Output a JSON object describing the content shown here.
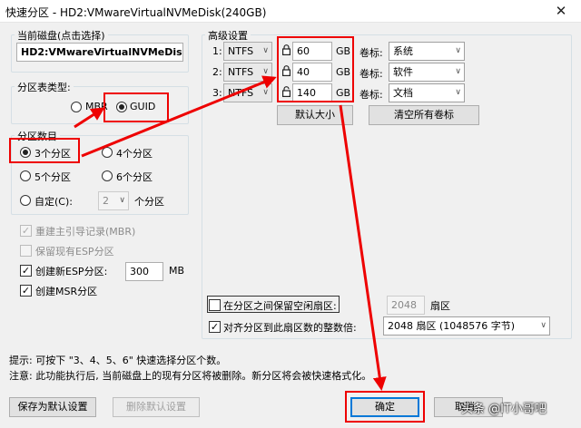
{
  "window": {
    "title": "快速分区 - HD2:VMwareVirtualNVMeDisk(240GB)",
    "close_glyph": "✕"
  },
  "disk": {
    "group_label": "当前磁盘(点击选择)",
    "name": "HD2:VMwareVirtualNVMeDisk"
  },
  "table_type": {
    "group_label": "分区表类型:",
    "options": [
      "MBR",
      "GUID"
    ],
    "selected": "GUID"
  },
  "count": {
    "group_label": "分区数目",
    "options": [
      "3个分区",
      "4个分区",
      "5个分区",
      "6个分区"
    ],
    "selected": "3个分区",
    "custom_label": "自定(C):",
    "custom_value": "2",
    "custom_suffix": "个分区"
  },
  "options": {
    "rebuild_mbr": "重建主引导记录(MBR)",
    "keep_esp": "保留现有ESP分区",
    "create_esp": "创建新ESP分区:",
    "esp_size": "300",
    "esp_unit": "MB",
    "create_msr": "创建MSR分区"
  },
  "advanced": {
    "group_label": "高级设置",
    "rows": [
      {
        "index": "1:",
        "fs": "NTFS",
        "size": "60",
        "unit": "GB",
        "vol_label": "卷标:",
        "volume": "系统"
      },
      {
        "index": "2:",
        "fs": "NTFS",
        "size": "40",
        "unit": "GB",
        "vol_label": "卷标:",
        "volume": "软件"
      },
      {
        "index": "3:",
        "fs": "NTFS",
        "size": "140",
        "unit": "GB",
        "vol_label": "卷标:",
        "volume": "文档"
      }
    ],
    "default_size_button": "默认大小",
    "clear_labels_button": "清空所有卷标",
    "keep_free_label": "在分区之间保留空闲扇区:",
    "keep_free_value": "2048",
    "keep_free_unit": "扇区",
    "align_label": "对齐分区到此扇区数的整数倍:",
    "align_value": "2048 扇区 (1048576 字节)"
  },
  "hints": {
    "tip": "提示: 可按下 \"3、4、5、6\" 快速选择分区个数。",
    "warning": "注意: 此功能执行后, 当前磁盘上的现有分区将被删除。新分区将会被快速格式化。"
  },
  "footer": {
    "save_default": "保存为默认设置",
    "delete_default": "删除默认设置",
    "ok": "确定",
    "cancel": "取消"
  },
  "watermark": "头条 @IT小哥吧",
  "colors": {
    "annotation": "#e00000",
    "focus": "#0078d7"
  }
}
